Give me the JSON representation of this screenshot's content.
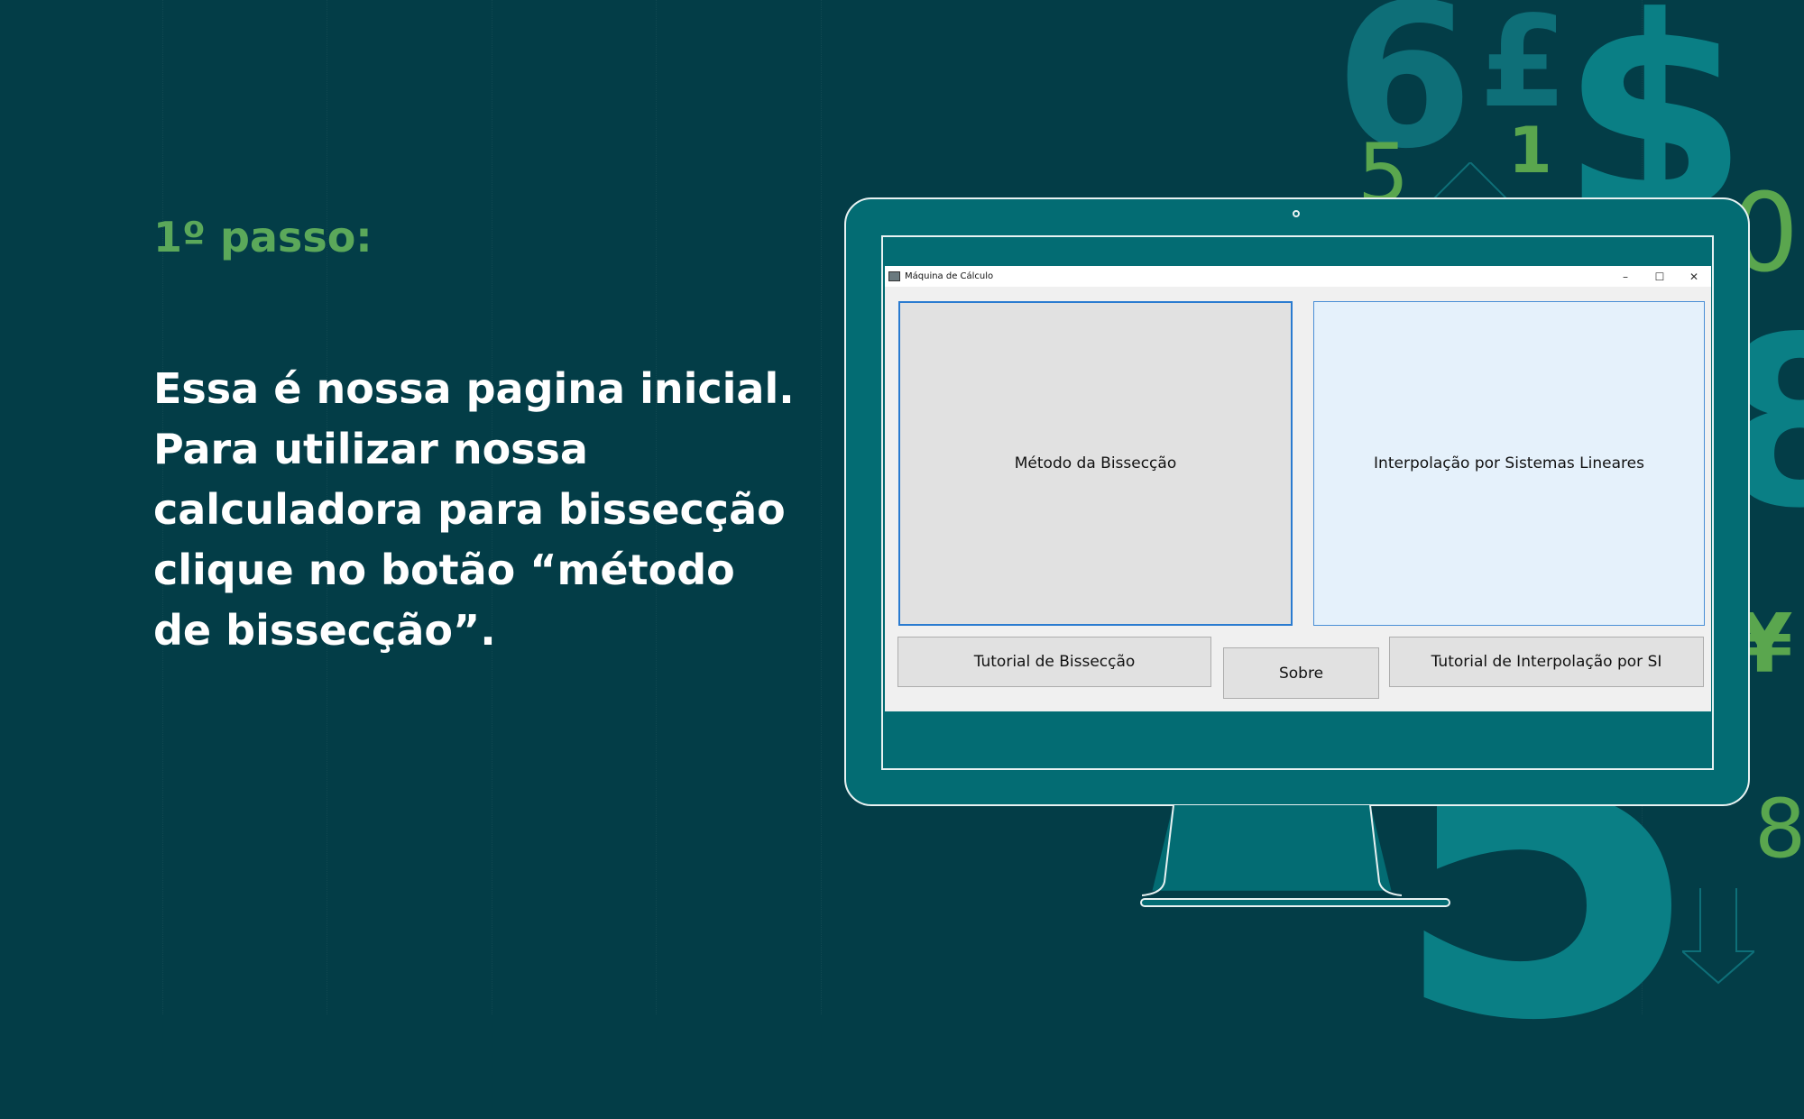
{
  "slide": {
    "step_title": "1º passo:",
    "description_lines": [
      "Essa é nossa pagina inicial.",
      "Para utilizar nossa",
      "calculadora para bissecção",
      "clique no botão “método",
      "de bissecção”."
    ]
  },
  "decor": {
    "glyphs": [
      "6",
      "£",
      "$",
      "1",
      "5",
      "1",
      "0",
      "8",
      "¥",
      "8",
      "5",
      "?"
    ]
  },
  "app": {
    "title": "Máquina de Cálculo",
    "controls": {
      "minimize": "–",
      "maximize": "☐",
      "close": "✕"
    },
    "buttons": {
      "bissection": "Método da Bissecção",
      "interpolation": "Interpolação por Sistemas Lineares",
      "tutorial_bissection": "Tutorial de Bissecção",
      "about": "Sobre",
      "tutorial_interpolation": "Tutorial de Interpolação por SI"
    }
  },
  "colors": {
    "background": "#033d47",
    "monitor": "#036c73",
    "accent_green": "#5ba85a",
    "focus_blue": "#2a7bd0"
  }
}
